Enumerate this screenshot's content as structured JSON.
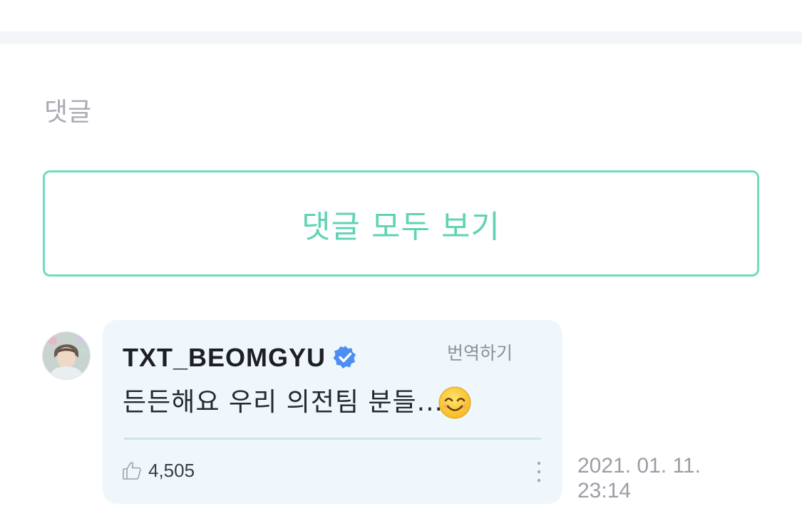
{
  "comments_section": {
    "title": "댓글",
    "view_all_label": "댓글 모두 보기",
    "accent_color": "#6fdcbf"
  },
  "comment": {
    "author": "TXT_BEOMGYU",
    "verified": true,
    "verified_icon": "verified-badge-icon",
    "translate_label": "번역하기",
    "text": "든든해요 우리 의전팀 분들...",
    "emoji": "😊",
    "like_icon": "thumbs-up-icon",
    "likes": "4,505",
    "more_icon": "vertical-ellipsis-icon",
    "timestamp_date": "2021. 01. 11.",
    "timestamp_time": "23:14",
    "bubble_color": "#eff7fc"
  }
}
